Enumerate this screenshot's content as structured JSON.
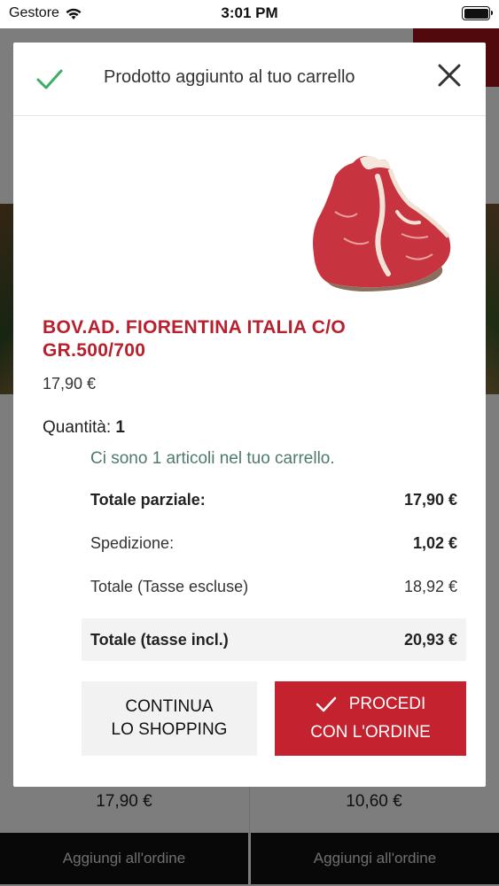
{
  "status_bar": {
    "carrier": "Gestore",
    "time": "3:01 PM"
  },
  "background": {
    "product_prices": [
      "17,90 €",
      "10,60 €"
    ],
    "add_buttons": [
      "Aggiungi all'ordine",
      "Aggiungi all'ordine"
    ],
    "accent_color": "#a3131c"
  },
  "modal": {
    "title": "Prodotto aggiunto al tuo carrello",
    "product": {
      "name": "BOV.AD. FIORENTINA ITALIA C/O GR.500/700",
      "price": "17,90 €",
      "image_icon": "steak-image"
    },
    "quantity_label": "Quantità:",
    "quantity_value": "1",
    "cart_message": "Ci sono 1 articoli nel tuo carrello.",
    "summary": [
      {
        "label": "Totale parziale:",
        "value": "17,90 €"
      },
      {
        "label": "Spedizione:",
        "value": "1,02 €"
      },
      {
        "label": "Totale (Tasse escluse)",
        "value": "18,92 €"
      },
      {
        "label": "Totale (tasse incl.)",
        "value": "20,93 €"
      }
    ],
    "buttons": {
      "continue_line1": "CONTINUA",
      "continue_line2": "LO SHOPPING",
      "proceed_line1": "PROCEDI",
      "proceed_line2": "CON L'ORDINE"
    },
    "colors": {
      "product_name": "#b8202e",
      "check": "#3cae63",
      "cart_message": "#4f7a6b",
      "proceed_bg": "#c3222e"
    }
  }
}
